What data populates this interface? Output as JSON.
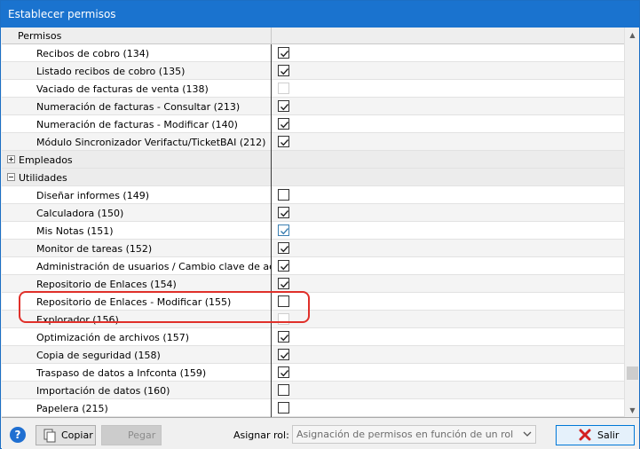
{
  "window": {
    "title": "Establecer permisos"
  },
  "grid": {
    "header": "Permisos",
    "rows": [
      {
        "label": "Recibos de cobro (134)",
        "type": "item",
        "checked": true,
        "disabled": false
      },
      {
        "label": "Listado recibos de cobro (135)",
        "type": "item",
        "checked": true,
        "disabled": false
      },
      {
        "label": "Vaciado de facturas de venta (138)",
        "type": "item",
        "checked": false,
        "disabled": true
      },
      {
        "label": "Numeración de facturas - Consultar (213)",
        "type": "item",
        "checked": true,
        "disabled": false
      },
      {
        "label": "Numeración de facturas - Modificar (140)",
        "type": "item",
        "checked": true,
        "disabled": false
      },
      {
        "label": "Módulo Sincronizador Verifactu/TicketBAI (212)",
        "type": "item",
        "checked": true,
        "disabled": false
      },
      {
        "label": "Empleados",
        "type": "group",
        "expanded": false
      },
      {
        "label": "Utilidades",
        "type": "group",
        "expanded": true
      },
      {
        "label": "Diseñar informes (149)",
        "type": "item",
        "checked": false,
        "disabled": false
      },
      {
        "label": "Calculadora (150)",
        "type": "item",
        "checked": true,
        "disabled": false
      },
      {
        "label": "Mis Notas (151)",
        "type": "item",
        "checked": true,
        "disabled": false,
        "blue": true
      },
      {
        "label": "Monitor de tareas (152)",
        "type": "item",
        "checked": true,
        "disabled": false
      },
      {
        "label": "Administración de usuarios / Cambio clave de acceso...",
        "type": "item",
        "checked": true,
        "disabled": false
      },
      {
        "label": "Repositorio de Enlaces (154)",
        "type": "item",
        "checked": true,
        "disabled": false
      },
      {
        "label": "Repositorio de Enlaces - Modificar (155)",
        "type": "item",
        "checked": false,
        "disabled": false
      },
      {
        "label": "Explorador (156)",
        "type": "item",
        "checked": false,
        "disabled": true
      },
      {
        "label": "Optimización de archivos (157)",
        "type": "item",
        "checked": true,
        "disabled": false
      },
      {
        "label": "Copia de seguridad (158)",
        "type": "item",
        "checked": true,
        "disabled": false
      },
      {
        "label": "Traspaso de datos a Infconta (159)",
        "type": "item",
        "checked": true,
        "disabled": false
      },
      {
        "label": "Importación de datos (160)",
        "type": "item",
        "checked": false,
        "disabled": false
      },
      {
        "label": "Papelera (215)",
        "type": "item",
        "checked": false,
        "disabled": false
      }
    ]
  },
  "footer": {
    "help_icon": "?",
    "copy_label": "Copiar",
    "paste_label": "Pegar",
    "assign_role_label": "Asignar rol:",
    "role_select_value": "Asignación de permisos en función de un rol",
    "exit_label": "Salir"
  },
  "icons": {
    "help": "help-icon",
    "copy": "copy-icon",
    "exit": "close-icon",
    "dropdown": "chevron-down-icon",
    "scroll_up": "chevron-up-icon",
    "scroll_down": "chevron-down-icon"
  },
  "colors": {
    "titlebar": "#1a73cf",
    "highlight": "#e0302a",
    "exit_icon": "#d32020"
  }
}
